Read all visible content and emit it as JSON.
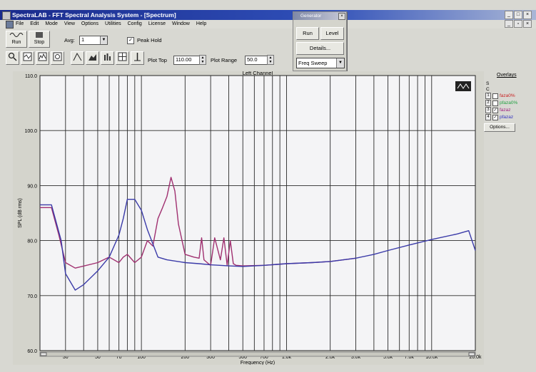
{
  "window": {
    "title": "SpectraLAB - FFT Spectral Analysis System - [Spectrum]"
  },
  "menu": [
    "File",
    "Edit",
    "Mode",
    "View",
    "Options",
    "Utilities",
    "Config",
    "License",
    "Window",
    "Help"
  ],
  "toolbar": {
    "run_label": "Run",
    "stop_label": "Stop",
    "avg_label": "Avg:",
    "avg_value": "1",
    "peak_hold_label": "Peak Hold",
    "peak_hold_checked": true,
    "plot_top_label": "Plot Top",
    "plot_top_value": "110.00",
    "plot_range_label": "Plot Range",
    "plot_range_value": "50.0"
  },
  "generator": {
    "title": "Generator",
    "run_label": "Run",
    "level_label": "Level",
    "details_label": "Details...",
    "mode_value": "Freq Sweep"
  },
  "overlays": {
    "title": "Overlays",
    "col_s": "S",
    "col_c": "C",
    "items": [
      {
        "num": "1",
        "label": "faza0%",
        "checked": false,
        "color": "#c82020"
      },
      {
        "num": "2",
        "label": "pfaza0%",
        "checked": false,
        "color": "#20a040"
      },
      {
        "num": "3",
        "label": "fazaz",
        "checked": true,
        "color": "#a02080"
      },
      {
        "num": "4",
        "label": "pfazaz",
        "checked": true,
        "color": "#3030c0"
      }
    ],
    "options_label": "Options..."
  },
  "chart_data": {
    "type": "line",
    "title": "Left Channel",
    "xlabel": "Frequency (Hz)",
    "ylabel": "SPL (dB rms)",
    "xscale": "log",
    "xlim": [
      20,
      20000
    ],
    "ylim": [
      60,
      110
    ],
    "yticks": [
      "110.0",
      "100.0",
      "90.0",
      "80.0",
      "70.0",
      "60.0"
    ],
    "xticks": [
      "30",
      "50",
      "70",
      "100",
      "200",
      "300",
      "500",
      "700",
      "1.0k",
      "2.0k",
      "3.0k",
      "5.0k",
      "7.0k",
      "10.0k",
      "20.0k"
    ],
    "grid": true,
    "series": [
      {
        "color": "#3a3aa8",
        "x": [
          20,
          24,
          28,
          30,
          35,
          40,
          50,
          60,
          70,
          75,
          80,
          90,
          100,
          110,
          130,
          150,
          200,
          250,
          300,
          400,
          500,
          700,
          1000,
          1500,
          2000,
          3000,
          4000,
          5000,
          7000,
          10000,
          15000,
          18000,
          20000
        ],
        "y": [
          86.5,
          86.5,
          80,
          74,
          71,
          72,
          74.5,
          77,
          81,
          84,
          87.5,
          87.5,
          85.5,
          82,
          77,
          76.5,
          76,
          75.8,
          75.6,
          75.4,
          75.3,
          75.5,
          75.8,
          76,
          76.2,
          76.8,
          77.5,
          78.2,
          79.2,
          80.2,
          81.2,
          81.8,
          78.2
        ]
      },
      {
        "color": "#a03070",
        "x": [
          20,
          24,
          27,
          30,
          35,
          50,
          60,
          70,
          75,
          80,
          90,
          100,
          110,
          120,
          130,
          140,
          150,
          160,
          170,
          180,
          200,
          230,
          250,
          260,
          270,
          290,
          300,
          320,
          350,
          370,
          390,
          410,
          430,
          450,
          500,
          700,
          1000,
          1500,
          2000,
          3000
        ],
        "y": [
          86,
          86,
          81,
          76,
          75,
          76,
          77,
          76,
          77,
          77.5,
          76,
          77,
          80,
          79,
          84,
          86,
          88,
          91.5,
          89,
          83,
          77.5,
          77,
          76.8,
          80.5,
          76.5,
          75.8,
          75.5,
          80.5,
          76.5,
          80.5,
          75.5,
          80,
          75.8,
          75.5,
          75.4,
          75.5,
          75.8,
          76,
          76.2,
          76.8
        ]
      }
    ]
  }
}
